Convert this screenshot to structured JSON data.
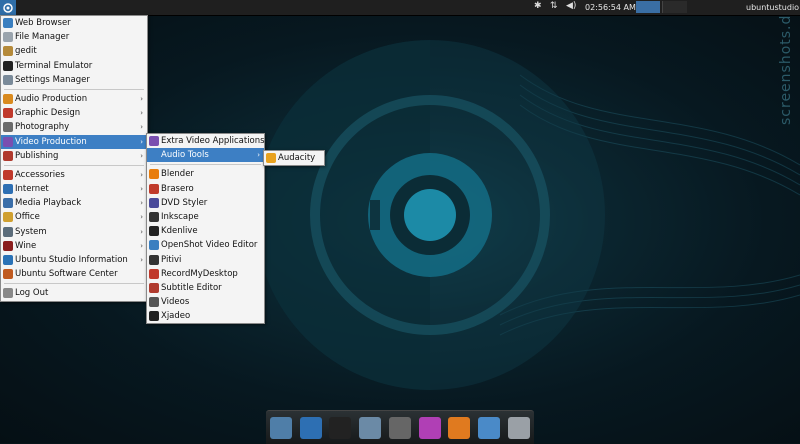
{
  "topbar": {
    "clock": "02:56:54 AM",
    "user": "ubuntustudio",
    "icons": [
      "applications-menu-icon",
      "bluetooth-icon",
      "network-icon",
      "volume-icon"
    ]
  },
  "main_menu": {
    "items": [
      {
        "label": "Web Browser",
        "icon": "globe-icon",
        "color": "#3a7fc0"
      },
      {
        "label": "File Manager",
        "icon": "folder-icon",
        "color": "#9aa4ad"
      },
      {
        "label": "gedit",
        "icon": "text-editor-icon",
        "color": "#b58a3a"
      },
      {
        "label": "Terminal Emulator",
        "icon": "terminal-icon",
        "color": "#222222"
      },
      {
        "label": "Settings Manager",
        "icon": "settings-icon",
        "color": "#7a8a99"
      },
      {
        "label": "Audio Production",
        "icon": "audio-icon",
        "color": "#d98a1f",
        "submenu": true
      },
      {
        "label": "Graphic Design",
        "icon": "graphics-icon",
        "color": "#c0392b",
        "submenu": true
      },
      {
        "label": "Photography",
        "icon": "camera-icon",
        "color": "#6b6b6b",
        "submenu": true
      },
      {
        "label": "Video Production",
        "icon": "film-icon",
        "color": "#7a4fb0",
        "submenu": true,
        "selected": true
      },
      {
        "label": "Publishing",
        "icon": "publishing-icon",
        "color": "#b03a2e",
        "submenu": true
      },
      {
        "label": "Accessories",
        "icon": "accessories-icon",
        "color": "#c0392b",
        "submenu": true
      },
      {
        "label": "Internet",
        "icon": "internet-icon",
        "color": "#2d6fb3",
        "submenu": true
      },
      {
        "label": "Media Playback",
        "icon": "media-icon",
        "color": "#3a6ea8",
        "submenu": true
      },
      {
        "label": "Office",
        "icon": "office-icon",
        "color": "#d0a030",
        "submenu": true
      },
      {
        "label": "System",
        "icon": "system-icon",
        "color": "#5b6c7a",
        "submenu": true
      },
      {
        "label": "Wine",
        "icon": "wine-icon",
        "color": "#8a1d1d",
        "submenu": true
      },
      {
        "label": "Ubuntu Studio Information",
        "icon": "info-icon",
        "color": "#2a72b6",
        "submenu": true
      },
      {
        "label": "Ubuntu Software Center",
        "icon": "software-center-icon",
        "color": "#c05a1f"
      },
      {
        "label": "Log Out",
        "icon": "logout-icon",
        "color": "#888888"
      }
    ]
  },
  "video_menu": {
    "items": [
      {
        "label": "Extra Video Applications",
        "icon": "extra-apps-icon",
        "color": "#7a4fb0"
      },
      {
        "label": "Audio Tools",
        "icon": "music-note-icon",
        "color": "#3d7fc4",
        "submenu": true,
        "selected": true
      },
      {
        "label": "Blender",
        "icon": "blender-icon",
        "color": "#e87d0d"
      },
      {
        "label": "Brasero",
        "icon": "brasero-icon",
        "color": "#c03a2b"
      },
      {
        "label": "DVD Styler",
        "icon": "dvd-icon",
        "color": "#4a4a9a"
      },
      {
        "label": "Inkscape",
        "icon": "inkscape-icon",
        "color": "#333333"
      },
      {
        "label": "Kdenlive",
        "icon": "kdenlive-icon",
        "color": "#222222"
      },
      {
        "label": "OpenShot Video Editor",
        "icon": "openshot-icon",
        "color": "#3a7fc0"
      },
      {
        "label": "Pitivi",
        "icon": "pitivi-icon",
        "color": "#333333"
      },
      {
        "label": "RecordMyDesktop",
        "icon": "record-icon",
        "color": "#c0392b"
      },
      {
        "label": "Subtitle Editor",
        "icon": "subtitle-icon",
        "color": "#b03a2e"
      },
      {
        "label": "Videos",
        "icon": "videos-icon",
        "color": "#555555"
      },
      {
        "label": "Xjadeo",
        "icon": "xjadeo-icon",
        "color": "#222222"
      }
    ]
  },
  "audio_tools_menu": {
    "items": [
      {
        "label": "Audacity",
        "icon": "audacity-icon",
        "color": "#e8a21f"
      }
    ]
  },
  "watermark": "screenshots.debian.net",
  "dock": {
    "items": [
      {
        "name": "show-desktop-icon",
        "color": "#4f7ea8"
      },
      {
        "name": "web-browser-icon",
        "color": "#2d6fb3"
      },
      {
        "name": "terminal-icon",
        "color": "#222222"
      },
      {
        "name": "settings-icon",
        "color": "#6b8aa6"
      },
      {
        "name": "search-icon",
        "color": "#666666"
      },
      {
        "name": "download-icon",
        "color": "#b03fb5"
      },
      {
        "name": "chat-icon",
        "color": "#e07a1f"
      },
      {
        "name": "folder-icon",
        "color": "#4a8ac8"
      },
      {
        "name": "trash-icon",
        "color": "#9aa0a6"
      }
    ]
  },
  "colors": {
    "accent": "#3d7fc4",
    "panel": "#1f1f1f",
    "menu_bg": "#f4f4f4"
  }
}
